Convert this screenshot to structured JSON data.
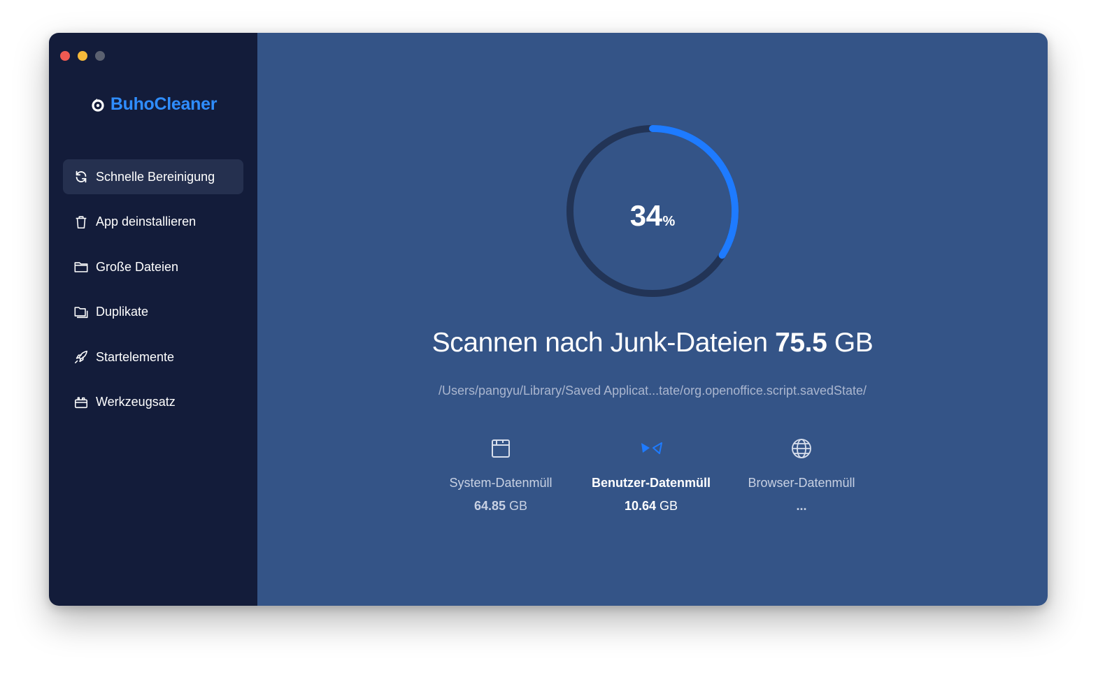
{
  "app": {
    "name": "BuhoCleaner",
    "accent": "#2f8dff"
  },
  "sidebar": {
    "items": [
      {
        "label": "Schnelle Bereinigung",
        "icon": "refresh-icon",
        "active": true
      },
      {
        "label": "App deinstallieren",
        "icon": "trash-icon",
        "active": false
      },
      {
        "label": "Große Dateien",
        "icon": "folder-icon",
        "active": false
      },
      {
        "label": "Duplikate",
        "icon": "duplicate-folder-icon",
        "active": false
      },
      {
        "label": "Startelemente",
        "icon": "rocket-icon",
        "active": false
      },
      {
        "label": "Werkzeugsatz",
        "icon": "toolbox-icon",
        "active": false
      }
    ]
  },
  "scan": {
    "progress_percent": 34,
    "progress_value": "34",
    "progress_unit": "%",
    "headline": "Scannen nach Junk-Dateien",
    "total_size": "75.5",
    "total_unit": "GB",
    "current_path": "/Users/pangyu/Library/Saved Applicat...tate/org.openoffice.script.savedState/"
  },
  "categories": [
    {
      "label": "System-Datenmüll",
      "value": "64.85",
      "unit": "GB",
      "icon": "disk-icon",
      "active": false
    },
    {
      "label": "Benutzer-Datenmüll",
      "value": "10.64",
      "unit": "GB",
      "icon": "scanning-icon",
      "active": true
    },
    {
      "label": "Browser-Datenmüll",
      "value": "...",
      "unit": "",
      "icon": "globe-icon",
      "active": false
    }
  ]
}
